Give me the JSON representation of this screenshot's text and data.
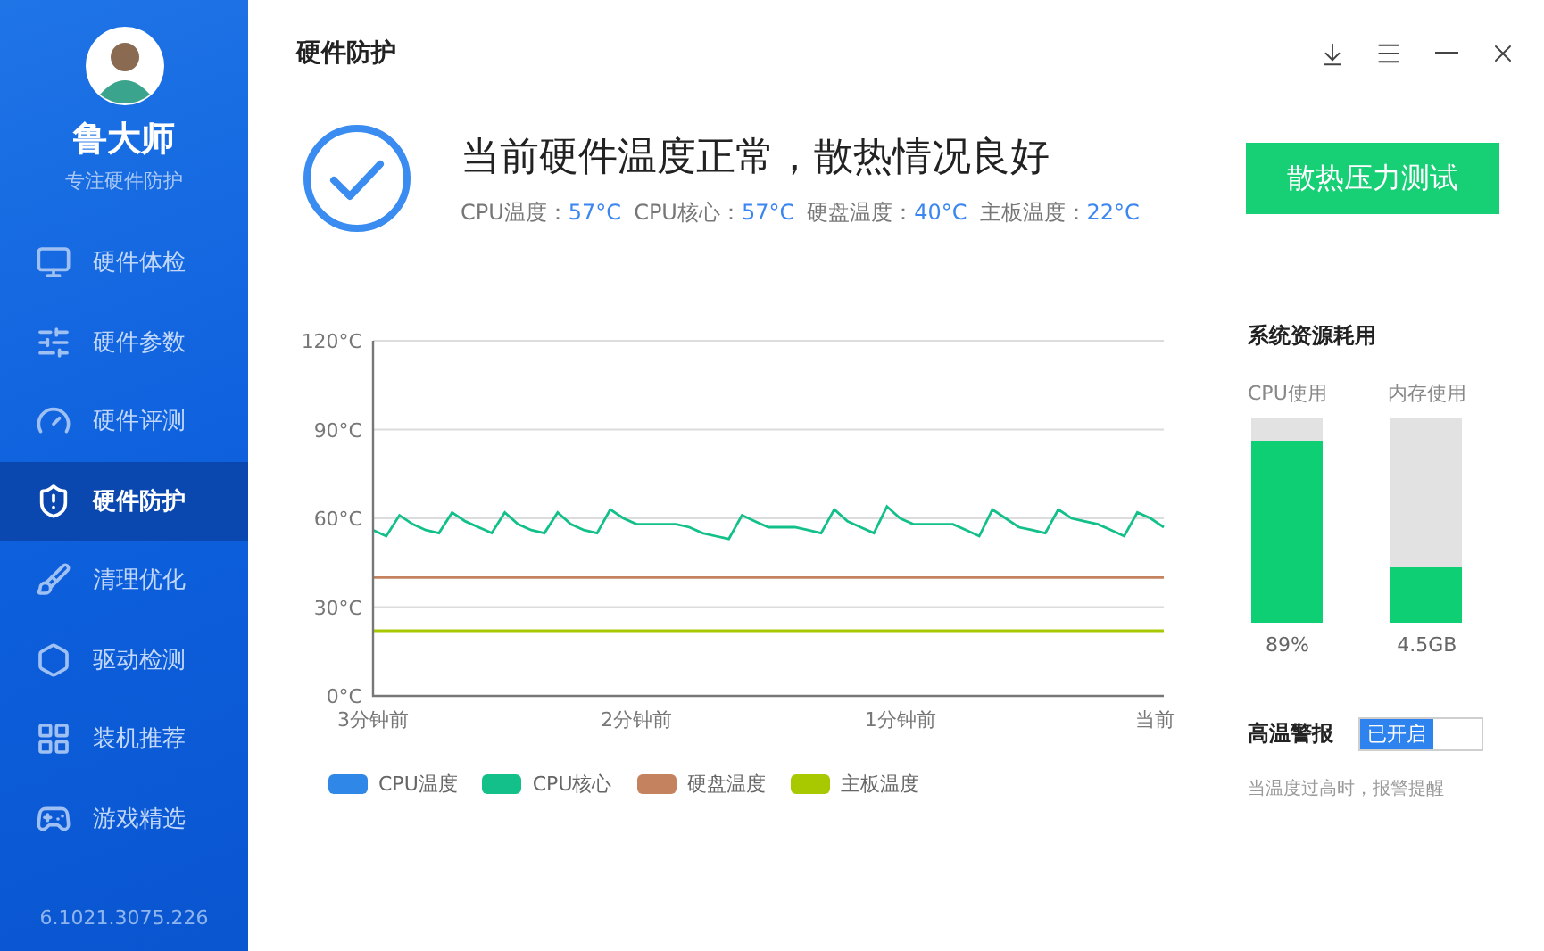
{
  "sidebar": {
    "brand": "鲁大师",
    "tagline": "专注硬件防护",
    "items": [
      {
        "kind": "monitor",
        "label": "硬件体检",
        "selected": false
      },
      {
        "kind": "sliders",
        "label": "硬件参数",
        "selected": false
      },
      {
        "kind": "gauge",
        "label": "硬件评测",
        "selected": false
      },
      {
        "kind": "shield",
        "label": "硬件防护",
        "selected": true
      },
      {
        "kind": "brush",
        "label": "清理优化",
        "selected": false
      },
      {
        "kind": "nut",
        "label": "驱动检测",
        "selected": false
      },
      {
        "kind": "grid",
        "label": "装机推荐",
        "selected": false
      },
      {
        "kind": "game",
        "label": "游戏精选",
        "selected": false
      }
    ],
    "version": "6.1021.3075.226"
  },
  "header": {
    "title": "硬件防护"
  },
  "status": {
    "headline": "当前硬件温度正常，散热情况良好",
    "readings": [
      {
        "label": "CPU温度：",
        "value": "57°C"
      },
      {
        "label": "CPU核心：",
        "value": "57°C"
      },
      {
        "label": "硬盘温度：",
        "value": "40°C"
      },
      {
        "label": "主板温度：",
        "value": "22°C"
      }
    ],
    "button": "散热压力测试"
  },
  "chart": {
    "chart_data": {
      "type": "line",
      "categories": [
        "3分钟前",
        null,
        null,
        null,
        null,
        null,
        null,
        null,
        null,
        null,
        null,
        null,
        null,
        null,
        null,
        null,
        null,
        null,
        null,
        null,
        "2分钟前",
        null,
        null,
        null,
        null,
        null,
        null,
        null,
        null,
        null,
        null,
        null,
        null,
        null,
        null,
        null,
        null,
        null,
        null,
        null,
        "1分钟前",
        null,
        null,
        null,
        null,
        null,
        null,
        null,
        null,
        null,
        null,
        null,
        null,
        null,
        null,
        null,
        null,
        null,
        null,
        null,
        "当前"
      ],
      "series": [
        {
          "name": "CPU温度",
          "color": "#2f87e8",
          "values": [
            null,
            null,
            null,
            null,
            null,
            null,
            null,
            null,
            null,
            null,
            null,
            null,
            null,
            null,
            null,
            null,
            null,
            null,
            null,
            null,
            null,
            null,
            null,
            null,
            null,
            null,
            null,
            null,
            null,
            null,
            null,
            null,
            null,
            null,
            null,
            null,
            null,
            null,
            null,
            null,
            null,
            null,
            null,
            null,
            null,
            null,
            null,
            null,
            null,
            null,
            null,
            null,
            null,
            null,
            null,
            null,
            null,
            null,
            null,
            null,
            null
          ]
        },
        {
          "name": "CPU核心",
          "color": "#13c08a",
          "values": [
            56,
            54,
            61,
            58,
            56,
            55,
            62,
            59,
            57,
            55,
            62,
            58,
            56,
            55,
            62,
            58,
            56,
            55,
            63,
            60,
            58,
            58,
            58,
            58,
            57,
            55,
            54,
            53,
            61,
            59,
            57,
            57,
            57,
            56,
            55,
            63,
            59,
            57,
            55,
            64,
            60,
            58,
            58,
            58,
            58,
            56,
            54,
            63,
            60,
            57,
            56,
            55,
            63,
            60,
            59,
            58,
            56,
            54,
            62,
            60,
            57
          ]
        },
        {
          "name": "硬盘温度",
          "color": "#c4825e",
          "values": [
            40,
            40,
            40,
            40,
            40,
            40,
            40,
            40,
            40,
            40,
            40,
            40,
            40,
            40,
            40,
            40,
            40,
            40,
            40,
            40,
            40,
            40,
            40,
            40,
            40,
            40,
            40,
            40,
            40,
            40,
            40,
            40,
            40,
            40,
            40,
            40,
            40,
            40,
            40,
            40,
            40,
            40,
            40,
            40,
            40,
            40,
            40,
            40,
            40,
            40,
            40,
            40,
            40,
            40,
            40,
            40,
            40,
            40,
            40,
            40,
            40
          ]
        },
        {
          "name": "主板温度",
          "color": "#a8c800",
          "values": [
            22,
            22,
            22,
            22,
            22,
            22,
            22,
            22,
            22,
            22,
            22,
            22,
            22,
            22,
            22,
            22,
            22,
            22,
            22,
            22,
            22,
            22,
            22,
            22,
            22,
            22,
            22,
            22,
            22,
            22,
            22,
            22,
            22,
            22,
            22,
            22,
            22,
            22,
            22,
            22,
            22,
            22,
            22,
            22,
            22,
            22,
            22,
            22,
            22,
            22,
            22,
            22,
            22,
            22,
            22,
            22,
            22,
            22,
            22,
            22,
            22
          ]
        }
      ],
      "ylim": [
        0,
        120
      ],
      "grid": true,
      "yticks": [
        {
          "value": 0,
          "label": "0°C"
        },
        {
          "value": 30,
          "label": "30°C"
        },
        {
          "value": 60,
          "label": "60°C"
        },
        {
          "value": 90,
          "label": "90°C"
        },
        {
          "value": 120,
          "label": "120°C"
        }
      ]
    }
  },
  "resources": {
    "title": "系统资源耗用",
    "meters": [
      {
        "label": "CPU使用",
        "level": 0.89,
        "reading": "89%"
      },
      {
        "label": "内存使用",
        "level": 0.27,
        "reading": "4.5GB"
      }
    ]
  },
  "alert": {
    "label": "高温警报",
    "toggle_text": "已开启",
    "on": true,
    "hint": "当温度过高时，报警提醒"
  }
}
